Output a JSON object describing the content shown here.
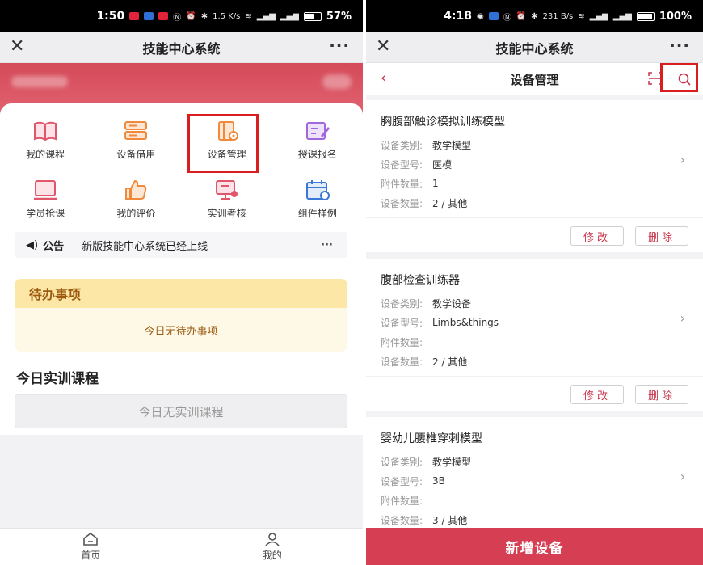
{
  "left": {
    "status": {
      "time": "1:50",
      "battery": "57%",
      "net": "1.5 K/s"
    },
    "titlebar": {
      "title": "技能中心系统"
    },
    "grid": [
      {
        "label": "我的课程",
        "icon": "book-icon"
      },
      {
        "label": "设备借用",
        "icon": "server-icon"
      },
      {
        "label": "设备管理",
        "icon": "device-manage-icon"
      },
      {
        "label": "授课报名",
        "icon": "edit-icon"
      },
      {
        "label": "学员抢课",
        "icon": "tablet-icon"
      },
      {
        "label": "我的评价",
        "icon": "thumb-up-icon"
      },
      {
        "label": "实训考核",
        "icon": "exam-icon"
      },
      {
        "label": "组件样例",
        "icon": "calendar-icon"
      }
    ],
    "notice": {
      "tag": "公告",
      "text": "新版技能中心系统已经上线",
      "more": "···"
    },
    "todo": {
      "title": "待办事项",
      "empty": "今日无待办事项"
    },
    "section": {
      "title": "今日实训课程",
      "empty": "今日无实训课程"
    },
    "tabs": [
      {
        "label": "首页",
        "icon": "home-icon"
      },
      {
        "label": "我的",
        "icon": "user-icon"
      }
    ]
  },
  "right": {
    "status": {
      "time": "4:18",
      "battery": "100%",
      "net": "231 B/s"
    },
    "titlebar": {
      "title": "技能中心系统"
    },
    "subnav": {
      "title": "设备管理"
    },
    "labels": {
      "category": "设备类别:",
      "model": "设备型号:",
      "accessories": "附件数量:",
      "count": "设备数量:"
    },
    "actions": {
      "edit": "修改",
      "delete": "删除"
    },
    "devices": [
      {
        "name": "胸腹部触诊模拟训练模型",
        "category": "教学模型",
        "model": "医模",
        "accessories": "1",
        "count": "2 / 其他"
      },
      {
        "name": "腹部检查训练器",
        "category": "教学设备",
        "model": "Limbs&things",
        "accessories": "",
        "count": "2 / 其他"
      },
      {
        "name": "婴幼儿腰椎穿刺模型",
        "category": "教学模型",
        "model": "3B",
        "accessories": "",
        "count": "3 / 其他"
      }
    ],
    "add_button": "新增设备"
  },
  "colors": {
    "accent": "#d53e53",
    "highlight": "#d81e1e",
    "todo_bg": "#fde7a7"
  }
}
